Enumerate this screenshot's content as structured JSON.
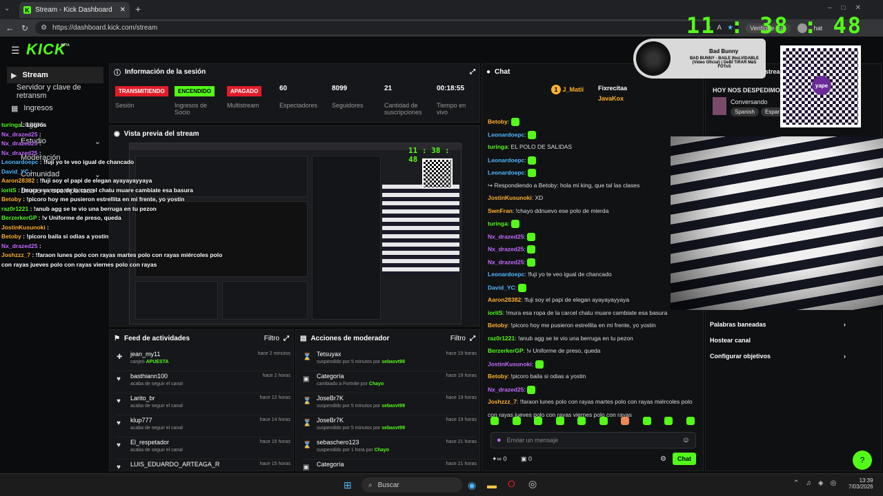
{
  "browser": {
    "tab_title": "Stream - Kick Dashboard",
    "url": "https://dashboard.kick.com/stream",
    "verify_text": "Verifique que",
    "chat_label": "hat"
  },
  "clock": "11 : 38 : 48",
  "music": {
    "artist": "Bad Bunny",
    "title": "BAD BUNNY - BAILE INoLVIDABLE (Video Oficial) | DeBÍ TiRAR MáS FOToS"
  },
  "sidebar": {
    "logo": "KICK",
    "beta": "BETA",
    "items": [
      "Stream",
      "Servidor y clave de retransm",
      "Ingresos",
      "Logros",
      "Estudio",
      "Moderación",
      "Comunidad",
      "Drops y recompensas"
    ]
  },
  "session": {
    "title": "Información de la sesión",
    "badges": [
      {
        "label": "TRANSMITIENDO",
        "sub": "Sesión",
        "color": "#e11d2a"
      },
      {
        "label": "ENCENDIDO",
        "sub": "Ingresos de Socio",
        "color": "#53fc18"
      },
      {
        "label": "APAGADO",
        "sub": "Multistream",
        "color": "#e11d2a"
      }
    ],
    "stats": [
      {
        "value": "60",
        "label": "Espectadores"
      },
      {
        "value": "8099",
        "label": "Seguidores"
      },
      {
        "value": "21",
        "label": "Cantidad de suscripciones"
      },
      {
        "value": "00:18:55",
        "label": "Tiempo en vivo"
      }
    ]
  },
  "preview": {
    "title": "Vista previa del stream"
  },
  "feed": {
    "title": "Feed de actividades",
    "filter": "Filtro",
    "rows": [
      {
        "name": "jean_my11",
        "sub": "canjeó",
        "hl": "APUESTA",
        "time": "hace 2 minutos",
        "icon": "✚"
      },
      {
        "name": "basthiann100",
        "sub": "acaba de seguir el canal",
        "hl": "",
        "time": "hace 2 horas",
        "icon": "♥"
      },
      {
        "name": "Larito_br",
        "sub": "acaba de seguir el canal",
        "hl": "",
        "time": "hace 12 horas",
        "icon": "♥"
      },
      {
        "name": "klup777",
        "sub": "acaba de seguir el canal",
        "hl": "",
        "time": "hace 14 horas",
        "icon": "♥"
      },
      {
        "name": "El_respetador",
        "sub": "acaba de seguir el canal",
        "hl": "",
        "time": "hace 15 horas",
        "icon": "♥"
      },
      {
        "name": "LUIS_EDUARDO_ARTEAGA_R",
        "sub": "",
        "hl": "",
        "time": "hace 15 horas",
        "icon": "♥"
      }
    ]
  },
  "mod": {
    "title": "Acciones de moderador",
    "filter": "Filtro",
    "rows": [
      {
        "name": "Tetsuyax",
        "sub": "suspendido por 5 minutos por",
        "by": "sebasvt99",
        "time": "hace 19 horas",
        "icon": "⌛"
      },
      {
        "name": "Categoría",
        "sub": "cambiado a Fortnite por",
        "by": "Chayo",
        "time": "hace 19 horas",
        "icon": "▣"
      },
      {
        "name": "JoseBr7K",
        "sub": "suspendido por 5 minutos por",
        "by": "sebasvt99",
        "time": "hace 19 horas",
        "icon": "⌛"
      },
      {
        "name": "JoseBr7K",
        "sub": "suspendido por 5 minutos por",
        "by": "sebasvt99",
        "time": "hace 19 horas",
        "icon": "⌛"
      },
      {
        "name": "sebaschero123",
        "sub": "suspendido por 1 hora por",
        "by": "Chayo",
        "time": "hace 21 horas",
        "icon": "⌛"
      },
      {
        "name": "Categoría",
        "sub": "",
        "by": "",
        "time": "hace 21 horas",
        "icon": "▣"
      }
    ]
  },
  "chat": {
    "title": "Chat",
    "top": [
      {
        "name": "J_Matii",
        "rank": "1"
      },
      {
        "name": "Fixrecitaa",
        "rank": "1"
      },
      {
        "name": "JavaKox",
        "rank": "1"
      }
    ],
    "lines": [
      {
        "user": "Betoby",
        "msg": "",
        "c": "u3"
      },
      {
        "user": "Leonardoepc",
        "msg": "",
        "c": "u4"
      },
      {
        "user": "turinga",
        "msg": "EL POLO DE SALIDAS",
        "c": "u1"
      },
      {
        "user": "Leonardoepc",
        "msg": "",
        "c": "u4"
      },
      {
        "user": "Leonardoepc",
        "msg": "",
        "c": "u4"
      },
      {
        "user": "",
        "msg": "↪ Respondiendo a Betoby: hola mi king, que tal las clases",
        "c": "u0"
      },
      {
        "user": "JostinKusunoki",
        "msg": "XD",
        "c": "u3"
      },
      {
        "user": "SwnFran",
        "msg": "!chayo ddnuevo ese polo de mierda",
        "c": "u3"
      },
      {
        "user": "turinga",
        "msg": "",
        "c": "u1"
      },
      {
        "user": "Nx_drazed25",
        "msg": "",
        "c": "u2"
      },
      {
        "user": "Nx_drazed25",
        "msg": "",
        "c": "u2"
      },
      {
        "user": "Nx_drazed25",
        "msg": "",
        "c": "u2"
      },
      {
        "user": "Leonardoepc",
        "msg": "!fuji yo te veo igual de chancado",
        "c": "u4"
      },
      {
        "user": "David_YC",
        "msg": "",
        "c": "u4"
      },
      {
        "user": "Aaron28382",
        "msg": "!fuji soy el papi de elegan ayayayayyaya",
        "c": "u3"
      },
      {
        "user": "ioritS",
        "msg": "!mura esa ropa de la carcel chatu muare cambiate esa basura",
        "c": "u1"
      },
      {
        "user": "Betoby",
        "msg": "!picoro hoy me pusieron estrellita en mi frente, yo yostin",
        "c": "u3"
      },
      {
        "user": "raz0r1221",
        "msg": "!anub agg se te vio una berruga en tu pezon",
        "c": "u1"
      },
      {
        "user": "BerzerkerGP",
        "msg": "!v Uniforme de preso, queda",
        "c": "u1"
      },
      {
        "user": "JostinKusunoki",
        "msg": "",
        "c": "u2"
      },
      {
        "user": "Betoby",
        "msg": "!picoro baila si odias a yostin",
        "c": "u3"
      },
      {
        "user": "Nx_drazed25",
        "msg": "",
        "c": "u2"
      },
      {
        "user": "Joshzzz_7",
        "msg": "!faraon lunes polo con rayas martes polo con rayas miércoles polo",
        "c": "u3"
      },
      {
        "user": "",
        "msg": "con rayas jueves polo con rayas viernes polo con rayas",
        "c": "u0"
      }
    ],
    "placeholder": "Enviar un mensaje",
    "send": "Chat",
    "count_a": "0",
    "count_b": "0"
  },
  "right_panel": {
    "stream_label": "stream",
    "title": "HOY NOS DESPEDIMOS",
    "category": "Conversando",
    "tags": [
      "Spanish",
      "Espar"
    ],
    "menu": [
      "Palabras baneadas",
      "Hostear canal",
      "Configurar objetivos"
    ]
  },
  "qr_label": "yape",
  "overlay_chat": [
    {
      "user": "turinga",
      "msg": "Logros",
      "c": "u1"
    },
    {
      "user": "Nx_drazed25",
      "msg": "",
      "c": "u2"
    },
    {
      "user": "Nx_drazed25",
      "msg": "",
      "c": "u2"
    },
    {
      "user": "Nx_drazed25",
      "msg": "",
      "c": "u2"
    },
    {
      "user": "Leonardoepc",
      "msg": "!fuji yo te veo igual de chancado",
      "c": "u4"
    },
    {
      "user": "David_YC",
      "msg": "",
      "c": "u4"
    },
    {
      "user": "Aaron28382",
      "msg": "!fuji soy el papi de elegan ayayayayyaya",
      "c": "u3"
    },
    {
      "user": "ioritS",
      "msg": "!mura esa ropa de la carcel chatu muare cambiate esa basura",
      "c": "u1"
    },
    {
      "user": "Betoby",
      "msg": "!picoro hoy me pusieron estrellita en mi frente, yo yostin",
      "c": "u3"
    },
    {
      "user": "raz0r1221",
      "msg": "!anub agg se te vio una berruga en tu pezon",
      "c": "u1"
    },
    {
      "user": "BerzerkerGP",
      "msg": "!v Uniforme de preso, queda",
      "c": "u1"
    },
    {
      "user": "JostinKusunoki",
      "msg": "",
      "c": "u3"
    },
    {
      "user": "Betoby",
      "msg": "!picoro baila si odias a yostin",
      "c": "u3"
    },
    {
      "user": "Nx_drazed25",
      "msg": "",
      "c": "u2"
    },
    {
      "user": "Joshzzz_7",
      "msg": "!faraon lunes polo con rayas martes polo con rayas miércoles polo",
      "c": "u3"
    },
    {
      "user": "",
      "msg": "con rayas jueves polo con rayas viernes polo con rayas",
      "c": "u3"
    }
  ],
  "taskbar": {
    "search": "Buscar",
    "time": "13:39",
    "date": "7/03/2026"
  }
}
